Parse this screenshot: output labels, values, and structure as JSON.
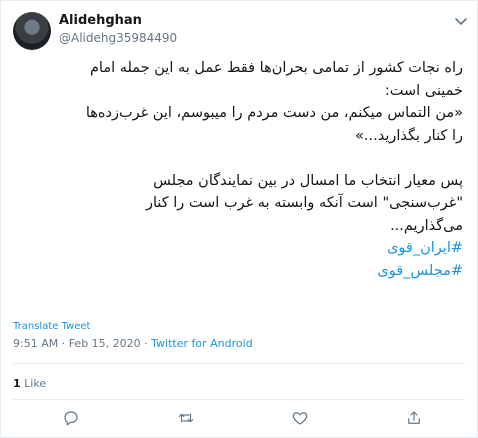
{
  "user": {
    "name": "Alidehghan",
    "handle": "@Alidehg35984490"
  },
  "tweet": {
    "lines": [
      "راه نجات کشور از تمامی بحران‌ها فقط عمل به این جمله امام",
      "خمینی است:",
      "«من التماس میکنم، من دست مردم را میبوسم، این غرب‌زده‌ها",
      "را کنار بگذارید...»",
      "",
      "پس معیار انتخاب ما امسال در بین نمایندگان مجلس",
      "\"غرب‌سنجی\" است آنکه وابسته به غرب است را کنار",
      "می‌گذاریم..."
    ],
    "hashtags": [
      "#ایران_قوی",
      "#مجلس_قوی"
    ]
  },
  "translate_label": "Translate Tweet",
  "timestamp": "9:51 AM · Feb 15, 2020 · ",
  "source": "Twitter for Android",
  "likes": {
    "count": "1",
    "label": "Like"
  },
  "icons": {
    "menu": "chevron-down-icon",
    "reply": "reply-icon",
    "retweet": "retweet-icon",
    "like": "heart-icon",
    "share": "share-icon"
  },
  "colors": {
    "link": "#1b95e0",
    "muted": "#657786",
    "text": "#14171a",
    "border": "#e6ecf0"
  }
}
